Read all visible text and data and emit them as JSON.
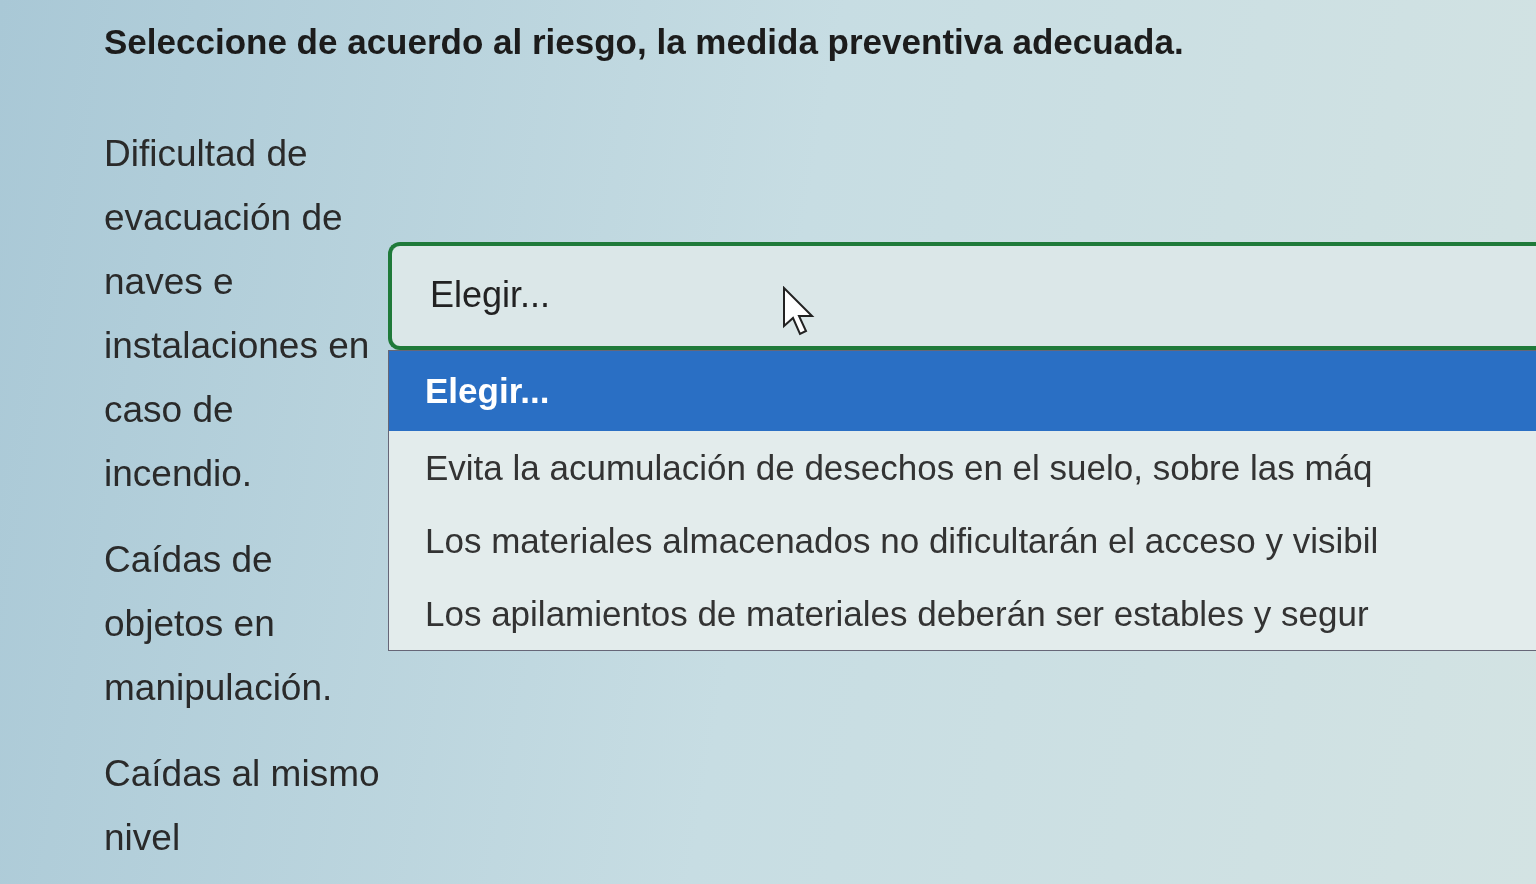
{
  "question": "Seleccione de acuerdo al riesgo, la medida preventiva adecuada.",
  "items": [
    {
      "risk": "Dificultad de evacuación de naves e instalaciones en caso de incendio.",
      "select": {
        "value": "Elegir...",
        "expanded": true,
        "options": [
          {
            "label": "Elegir...",
            "selected": true
          },
          {
            "label": "Evita la acumulación de desechos en el suelo, sobre las máq",
            "selected": false
          },
          {
            "label": "Los materiales almacenados no dificultarán el acceso y visibil",
            "selected": false
          },
          {
            "label": "Los apilamientos de materiales deberán ser estables y segur",
            "selected": false
          }
        ]
      }
    },
    {
      "risk": "Caídas de objetos en manipulación."
    },
    {
      "risk": "Caídas al mismo nivel"
    }
  ]
}
